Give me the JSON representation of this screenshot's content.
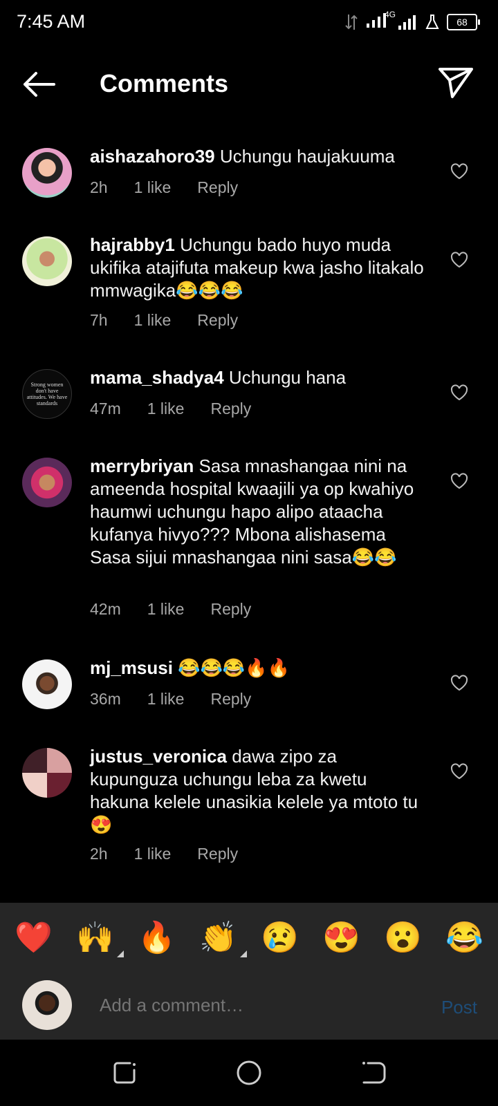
{
  "status_bar": {
    "time": "7:45 AM",
    "network": "4G",
    "battery": "68"
  },
  "header": {
    "title": "Comments"
  },
  "comments": [
    {
      "user": "aishazahoro39",
      "text": "Uchungu haujakuuma",
      "time": "2h",
      "likes": "1 like",
      "reply": "Reply"
    },
    {
      "user": "hajrabby1",
      "text": "Uchungu bado huyo muda ukifika  atajifuta makeup kwa jasho litakalo mmwagika😂😂😂",
      "time": "7h",
      "likes": "1 like",
      "reply": "Reply"
    },
    {
      "user": "mama_shadya4",
      "text": "Uchungu hana",
      "time": "47m",
      "likes": "1 like",
      "reply": "Reply",
      "avatar_text": "Strong women don't have attitudes. We have standards"
    },
    {
      "user": "merrybriyan",
      "text": "Sasa mnashangaa nini na ameenda hospital kwaajili ya op kwahiyo haumwi uchungu hapo alipo ataacha kufanya hivyo??? Mbona alishasema Sasa sijui mnashangaa nini sasa😂😂",
      "time": "42m",
      "likes": "1 like",
      "reply": "Reply"
    },
    {
      "user": "mj_msusi",
      "text": "😂😂😂🔥🔥",
      "time": "36m",
      "likes": "1 like",
      "reply": "Reply"
    },
    {
      "user": "justus_veronica",
      "text": "dawa zipo za kupunguza uchungu  leba za kwetu hakuna kelele unasikia kelele ya mtoto tu😍",
      "time": "2h",
      "likes": "1 like",
      "reply": "Reply"
    }
  ],
  "reactions": [
    "❤️",
    "🙌",
    "🔥",
    "👏",
    "😢",
    "😍",
    "😮",
    "😂"
  ],
  "composer": {
    "placeholder": "Add a comment…",
    "post_label": "Post"
  },
  "colors": {
    "background": "#000000",
    "panel": "#262626",
    "meta_text": "#a8a8a8",
    "post_disabled": "#1e4d78"
  }
}
